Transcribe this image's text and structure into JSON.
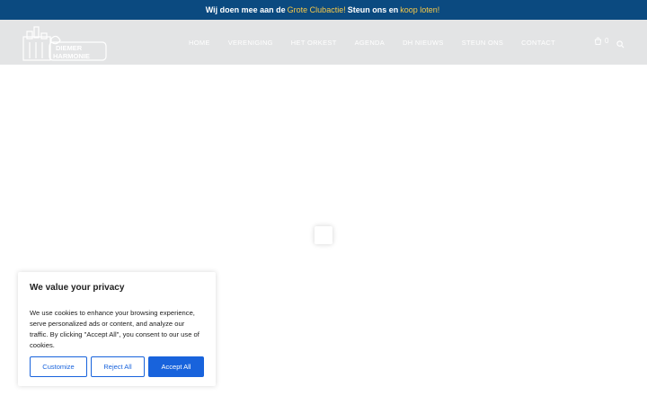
{
  "announcement": {
    "part1": "Wij doen mee aan de",
    "link1": "Grote Clubactie!",
    "part2": "Steun ons en",
    "link2": "koop loten!"
  },
  "header": {
    "logo_text_1": "DIEMER",
    "logo_text_2": "HARMONIE",
    "nav": [
      "HOME",
      "VERENIGING",
      "HET ORKEST",
      "AGENDA",
      "DH NIEUWS",
      "STEUN ONS",
      "CONTACT"
    ],
    "cart_count": "0"
  },
  "cookie": {
    "title": "We value your privacy",
    "text": "We use cookies to enhance your browsing experience, serve personalized ads or content, and analyze our traffic. By clicking \"Accept All\", you consent to our use of cookies.",
    "customize": "Customize",
    "reject": "Reject All",
    "accept": "Accept All"
  },
  "colors": {
    "topbar_bg": "#0b4a80",
    "link_accent": "#f7c948",
    "header_bg": "#e3e4e5",
    "button_blue": "#1863dc"
  }
}
